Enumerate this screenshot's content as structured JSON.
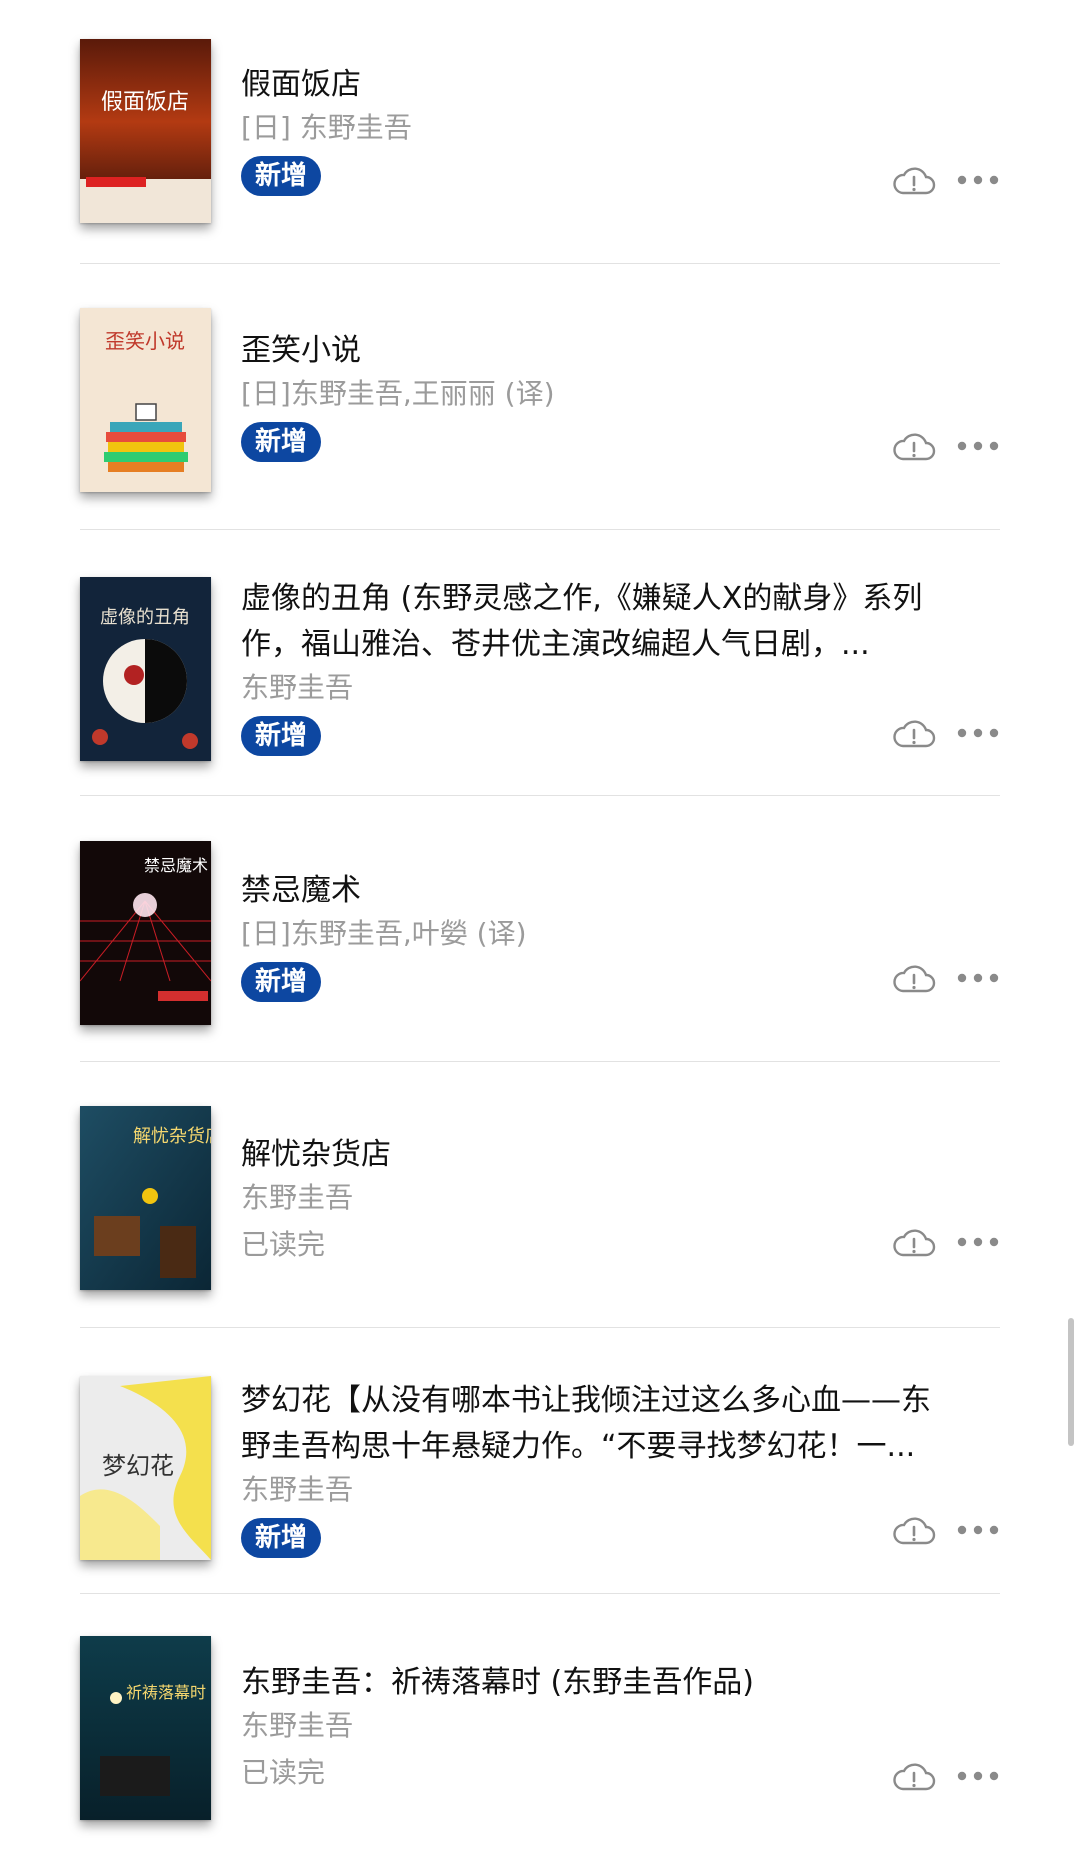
{
  "books": [
    {
      "title": "假面饭店",
      "author": "[日] 东野圭吾",
      "status": "新增",
      "status_type": "badge",
      "cover_text": "假面饭店"
    },
    {
      "title": "歪笑小说",
      "author": "[日]东野圭吾,王丽丽 (译)",
      "status": "新增",
      "status_type": "badge",
      "cover_text": "歪笑小说"
    },
    {
      "title": "虚像的丑角 (东野灵感之作,《嫌疑人X的献身》系列作，福山雅治、苍井优主演改编超人气日剧，...",
      "author": "东野圭吾",
      "status": "新增",
      "status_type": "badge",
      "cover_text": "虚像的丑角"
    },
    {
      "title": "禁忌魔术",
      "author": "[日]东野圭吾,叶嫈 (译)",
      "status": "新增",
      "status_type": "badge",
      "cover_text": "禁忌魔术"
    },
    {
      "title": "解忧杂货店",
      "author": "东野圭吾",
      "status": "已读完",
      "status_type": "text",
      "cover_text": "解忧杂货店"
    },
    {
      "title": "梦幻花【从没有哪本书让我倾注过这么多心血——东野圭吾构思十年悬疑力作。“不要寻找梦幻花！一...",
      "author": "东野圭吾",
      "status": "新增",
      "status_type": "badge",
      "cover_text": "梦幻花"
    },
    {
      "title": "东野圭吾：祈祷落幕时 (东野圭吾作品)",
      "author": "东野圭吾",
      "status": "已读完",
      "status_type": "text",
      "cover_text": "祈祷落幕时"
    }
  ],
  "colors": {
    "badge_bg": "#0d47a1",
    "muted_text": "#9b9b9b",
    "divider": "#e2e2e2"
  },
  "icons": {
    "cloud": "cloud-alert-icon",
    "more": "more-dots-icon"
  }
}
